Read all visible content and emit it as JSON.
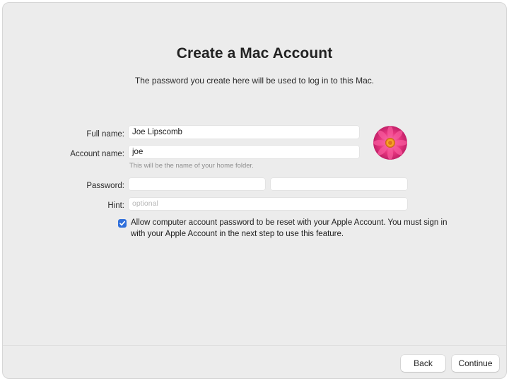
{
  "header": {
    "title": "Create a Mac Account",
    "subtitle": "The password you create here will be used to log in to this Mac."
  },
  "form": {
    "full_name": {
      "label": "Full name:",
      "value": "Joe Lipscomb"
    },
    "account_name": {
      "label": "Account name:",
      "value": "joe",
      "helper": "This will be the name of your home folder."
    },
    "password": {
      "label": "Password:",
      "value": "",
      "verify_value": ""
    },
    "hint": {
      "label": "Hint:",
      "value": "",
      "placeholder": "optional"
    },
    "reset_option": {
      "checked": true,
      "label": "Allow computer account password to be reset with your Apple Account. You must sign in with your Apple Account in the next step to use this feature."
    }
  },
  "avatar": {
    "icon": "flower-avatar"
  },
  "footer": {
    "back_label": "Back",
    "continue_label": "Continue"
  },
  "colors": {
    "checkbox_accent": "#2f6fdb",
    "avatar_petals": "#e8357f"
  }
}
